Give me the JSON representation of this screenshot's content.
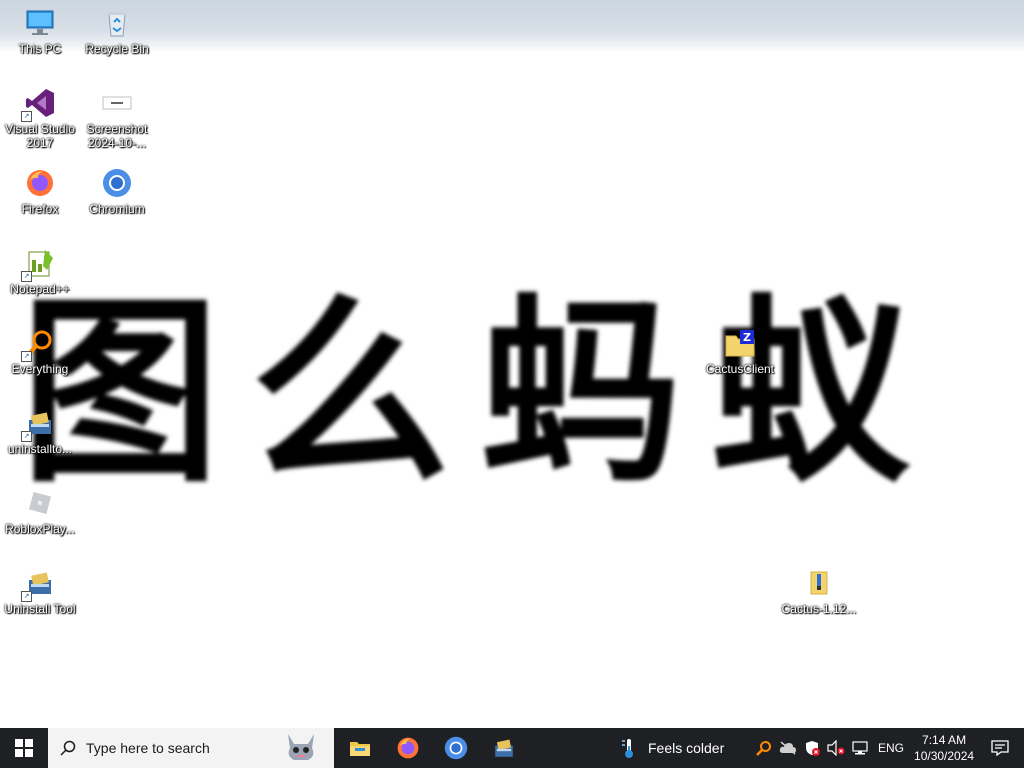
{
  "desktop": {
    "big_text": "图么蚂蚁",
    "icons": [
      {
        "label": "This PC",
        "icon": "this-pc-icon"
      },
      {
        "label": "Recycle Bin",
        "icon": "recycle-bin-icon"
      },
      {
        "label": "Visual Studio 2017",
        "icon": "visual-studio-icon"
      },
      {
        "label": "Screenshot 2024-10-...",
        "icon": "screenshot-file-icon"
      },
      {
        "label": "Firefox",
        "icon": "firefox-icon"
      },
      {
        "label": "Chromium",
        "icon": "chromium-icon"
      },
      {
        "label": "Notepad++",
        "icon": "notepad-plus-plus-icon"
      },
      {
        "label": "Everything",
        "icon": "everything-search-icon"
      },
      {
        "label": "uninstallto...",
        "icon": "installer-icon"
      },
      {
        "label": "RobloxPlay...",
        "icon": "roblox-icon"
      },
      {
        "label": "Uninstall Tool",
        "icon": "uninstall-tool-icon"
      },
      {
        "label": "CactusClient",
        "icon": "folder-zip-icon"
      },
      {
        "label": "Cactus-1.12...",
        "icon": "archive-icon"
      }
    ]
  },
  "taskbar": {
    "search_placeholder": "Type here to search",
    "pinned": [
      "file-explorer-icon",
      "firefox-icon",
      "chromium-icon",
      "uninstall-tool-icon"
    ],
    "weather_text": "Feels colder",
    "language": "ENG",
    "time": "7:14 AM",
    "date": "10/30/2024"
  },
  "colors": {
    "taskbar_bg": "#1f2023",
    "search_bg": "#f3f3f3",
    "accent_blue": "#0078d7"
  }
}
